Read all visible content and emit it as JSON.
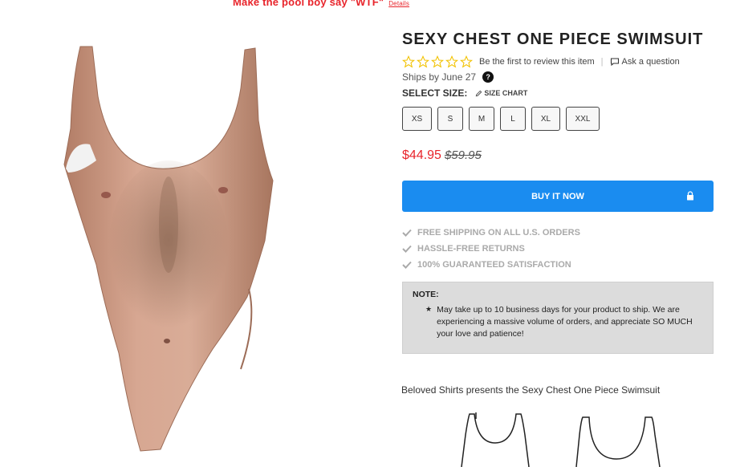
{
  "promo": {
    "text": "Make the pool boy say \"WTF\"",
    "details": "Details"
  },
  "product": {
    "title": "SEXY CHEST ONE PIECE SWIMSUIT",
    "review_text": "Be the first to review this item",
    "ask_text": "Ask a question",
    "ships": "Ships by June 27",
    "ships_help": "?",
    "select_size_label": "SELECT SIZE:",
    "size_chart_label": "SIZE CHART",
    "sizes": [
      "XS",
      "S",
      "M",
      "L",
      "XL",
      "XXL"
    ],
    "price": "$44.95",
    "old_price": "$59.95",
    "buy_label": "BUY IT NOW"
  },
  "perks": [
    "FREE SHIPPING ON ALL U.S. ORDERS",
    "HASSLE-FREE RETURNS",
    "100% GUARANTEED SATISFACTION"
  ],
  "note": {
    "title": "NOTE:",
    "body": "May take up to 10 business days for your product to ship. We are experiencing a massive volume of orders, and appreciate SO MUCH your love and patience!"
  },
  "description": "Beloved Shirts presents the Sexy Chest One Piece Swimsuit",
  "colors": {
    "accent_red": "#e8242b",
    "button_blue": "#1a8cf0",
    "star_yellow": "#f2c200"
  },
  "icons": [
    "star-icon",
    "chat-bubble-icon",
    "pencil-icon",
    "lock-icon",
    "check-icon"
  ]
}
